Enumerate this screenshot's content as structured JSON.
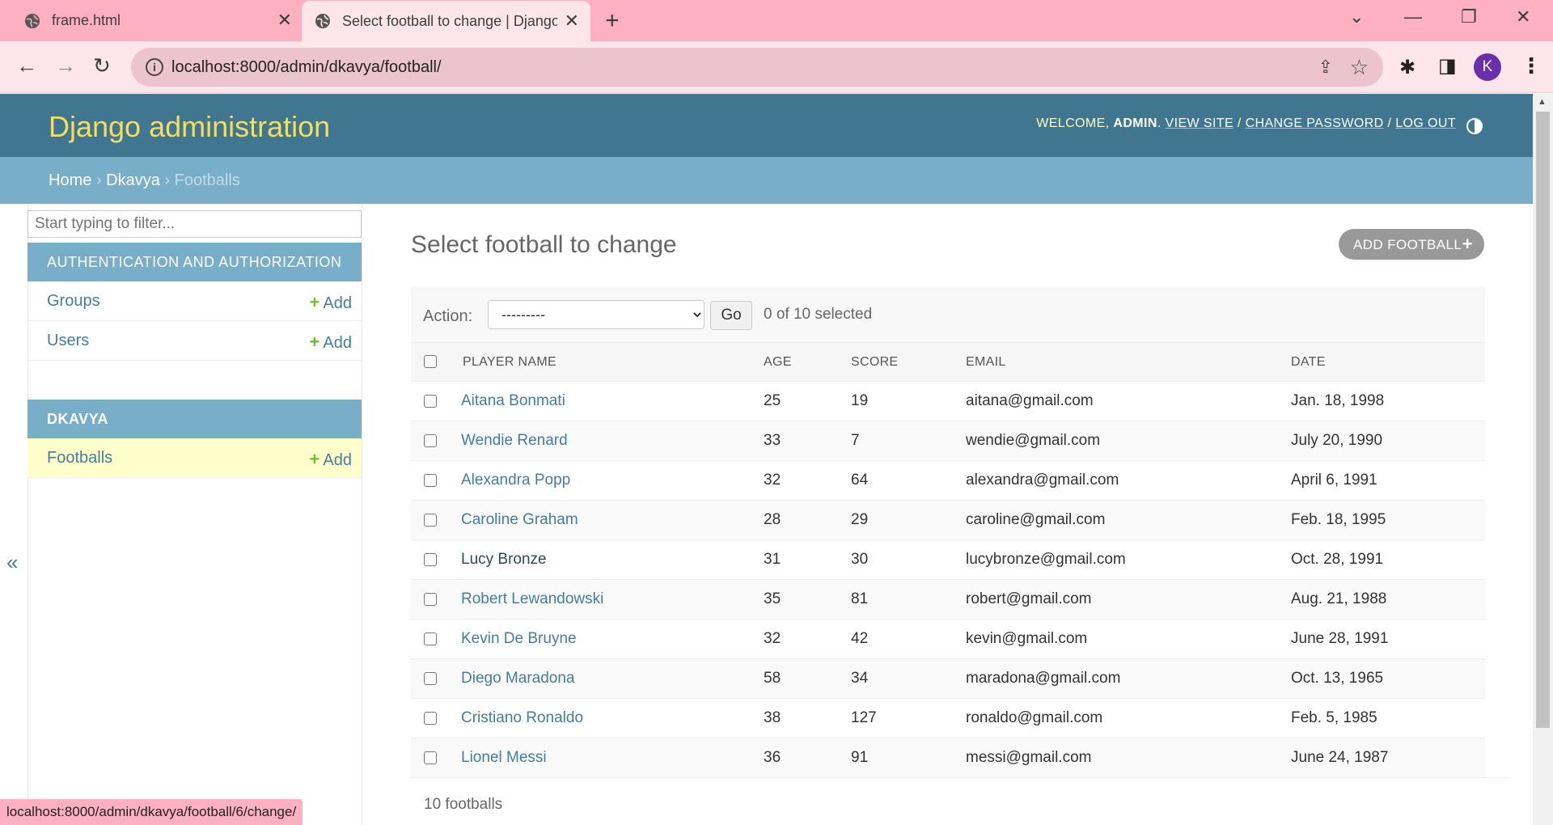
{
  "browser": {
    "tabs": [
      {
        "title": "frame.html"
      },
      {
        "title": "Select football to change | Django site admin"
      }
    ],
    "url": "localhost:8000/admin/dkavya/football/",
    "profile_initial": "K",
    "status_url": "localhost:8000/admin/dkavya/football/6/change/"
  },
  "header": {
    "branding": "Django administration",
    "welcome": "WELCOME,",
    "user": "ADMIN",
    "view_site": "VIEW SITE",
    "change_password": "CHANGE PASSWORD",
    "log_out": "LOG OUT"
  },
  "breadcrumbs": {
    "home": "Home",
    "app": "Dkavya",
    "current": "Footballs"
  },
  "sidebar": {
    "filter_placeholder": "Start typing to filter...",
    "modules": [
      {
        "caption": "AUTHENTICATION AND AUTHORIZATION",
        "rows": [
          {
            "name": "Groups",
            "add": "Add"
          },
          {
            "name": "Users",
            "add": "Add"
          }
        ]
      },
      {
        "caption": "DKAVYA",
        "rows": [
          {
            "name": "Footballs",
            "add": "Add"
          }
        ]
      }
    ],
    "collapse": "«"
  },
  "content": {
    "title": "Select football to change",
    "add_button": "ADD FOOTBALL",
    "action_label": "Action:",
    "action_selected": "---------",
    "go": "Go",
    "counter": "0 of 10 selected",
    "columns": [
      "PLAYER NAME",
      "AGE",
      "SCORE",
      "EMAIL",
      "DATE"
    ],
    "rows": [
      {
        "name": "Aitana Bonmati",
        "age": "25",
        "score": "19",
        "email": "aitana@gmail.com",
        "date": "Jan. 18, 1998"
      },
      {
        "name": "Wendie Renard",
        "age": "33",
        "score": "7",
        "email": "wendie@gmail.com",
        "date": "July 20, 1990"
      },
      {
        "name": "Alexandra Popp",
        "age": "32",
        "score": "64",
        "email": "alexandra@gmail.com",
        "date": "April 6, 1991"
      },
      {
        "name": "Caroline Graham",
        "age": "28",
        "score": "29",
        "email": "caroline@gmail.com",
        "date": "Feb. 18, 1995"
      },
      {
        "name": "Lucy Bronze",
        "age": "31",
        "score": "30",
        "email": "lucybronze@gmail.com",
        "date": "Oct. 28, 1991"
      },
      {
        "name": "Robert Lewandowski",
        "age": "35",
        "score": "81",
        "email": "robert@gmail.com",
        "date": "Aug. 21, 1988"
      },
      {
        "name": "Kevin De Bruyne",
        "age": "32",
        "score": "42",
        "email": "kevin@gmail.com",
        "date": "June 28, 1991"
      },
      {
        "name": "Diego Maradona",
        "age": "58",
        "score": "34",
        "email": "maradona@gmail.com",
        "date": "Oct. 13, 1965"
      },
      {
        "name": "Cristiano Ronaldo",
        "age": "38",
        "score": "127",
        "email": "ronaldo@gmail.com",
        "date": "Feb. 5, 1985"
      },
      {
        "name": "Lionel Messi",
        "age": "36",
        "score": "91",
        "email": "messi@gmail.com",
        "date": "June 24, 1987"
      }
    ],
    "paginator": "10 footballs"
  },
  "colors": {
    "header_bg": "#417690",
    "breadcrumb_bg": "#79aec8",
    "branding": "#f5dd5d",
    "link": "#447e9b",
    "add_plus": "#70bf2b",
    "current_module_bg": "#ffffcc",
    "tabbar_bg": "#fdb0c0"
  }
}
